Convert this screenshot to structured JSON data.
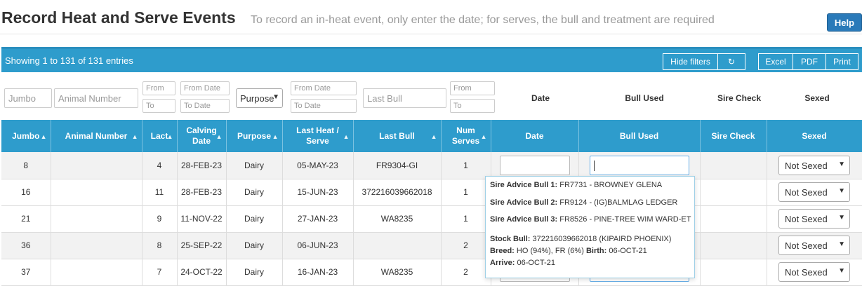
{
  "header": {
    "title": "Record Heat and Serve Events",
    "subtitle": "To record an in-heat event, only enter the date; for serves, the bull and treatment are required",
    "help_label": "Help"
  },
  "toolbar": {
    "info": "Showing 1 to 131 of 131 entries",
    "hide_filters": "Hide filters",
    "refresh_icon": "refresh-icon",
    "excel": "Excel",
    "pdf": "PDF",
    "print": "Print"
  },
  "filters": {
    "jumbo_placeholder": "Jumbo",
    "animal_placeholder": "Animal Number",
    "lact_from": "From",
    "lact_to": "To",
    "calving_from": "From Date",
    "calving_to": "To Date",
    "purpose_value": "Purpose",
    "last_heat_from": "From Date",
    "last_heat_to": "To Date",
    "last_bull_placeholder": "Last Bull",
    "num_from": "From",
    "num_to": "To",
    "date_label": "Date",
    "bull_used_label": "Bull Used",
    "sire_check_label": "Sire Check",
    "sexed_label": "Sexed"
  },
  "columns": [
    "Jumbo",
    "Animal Number",
    "Lact",
    "Calving Date",
    "Purpose",
    "Last Heat / Serve",
    "Last Bull",
    "Num Serves",
    "Date",
    "Bull Used",
    "Sire Check",
    "Sexed"
  ],
  "rows": [
    {
      "jumbo": "8",
      "animal": "",
      "lact": "4",
      "calving": "28-FEB-23",
      "purpose": "Dairy",
      "last_heat": "05-MAY-23",
      "last_bull": "FR9304-GI",
      "num": "1",
      "sexed": "Not Sexed"
    },
    {
      "jumbo": "16",
      "animal": "",
      "lact": "11",
      "calving": "28-FEB-23",
      "purpose": "Dairy",
      "last_heat": "15-JUN-23",
      "last_bull": "372216039662018",
      "num": "1",
      "sexed": "Not Sexed"
    },
    {
      "jumbo": "21",
      "animal": "",
      "lact": "9",
      "calving": "11-NOV-22",
      "purpose": "Dairy",
      "last_heat": "27-JAN-23",
      "last_bull": "WA8235",
      "num": "1",
      "sexed": "Not Sexed"
    },
    {
      "jumbo": "36",
      "animal": "",
      "lact": "8",
      "calving": "25-SEP-22",
      "purpose": "Dairy",
      "last_heat": "06-JUN-23",
      "last_bull": "",
      "num": "2",
      "sexed": "Not Sexed"
    },
    {
      "jumbo": "37",
      "animal": "",
      "lact": "7",
      "calving": "24-OCT-22",
      "purpose": "Dairy",
      "last_heat": "16-JAN-23",
      "last_bull": "WA8235",
      "num": "2",
      "sexed": "Not Sexed"
    }
  ],
  "popup": {
    "advice": [
      {
        "label": "Sire Advice Bull 1:",
        "value": "FR7731 - BROWNEY GLENA"
      },
      {
        "label": "Sire Advice Bull 2:",
        "value": "FR9124 - (IG)BALMLAG LEDGER"
      },
      {
        "label": "Sire Advice Bull 3:",
        "value": "FR8526 - PINE-TREE WIM WARD-ET"
      }
    ],
    "stock_label": "Stock Bull:",
    "stock_value": "372216039662018 (KIPAIRD PHOENIX)",
    "breed_label": "Breed:",
    "breed_value": "HO (94%), FR (6%)",
    "birth_label": "Birth:",
    "birth_value": "06-OCT-21",
    "arrive_label": "Arrive:",
    "arrive_value": "06-OCT-21"
  },
  "colors": {
    "accent": "#2e9ccc",
    "link": "#2a7ab9",
    "help": "#2a7ab9"
  }
}
